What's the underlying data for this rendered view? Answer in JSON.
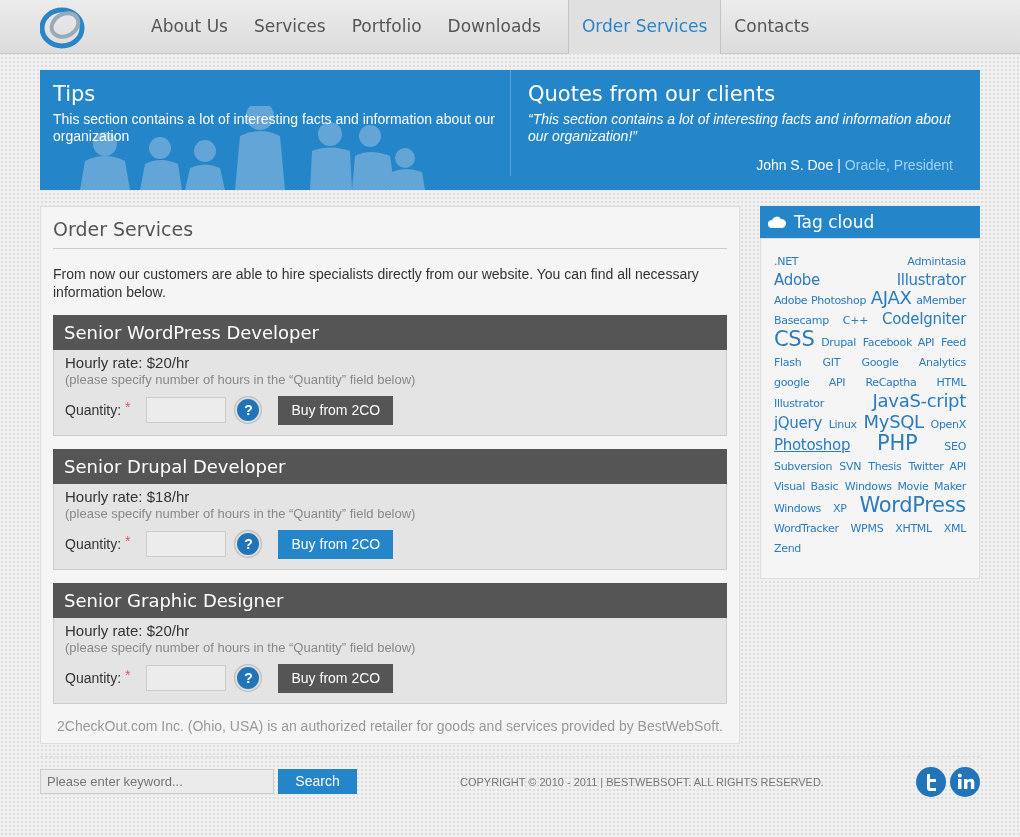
{
  "nav": [
    {
      "label": "About Us",
      "selected": false
    },
    {
      "label": "Services",
      "selected": false
    },
    {
      "label": "Portfolio",
      "selected": false
    },
    {
      "label": "Downloads",
      "selected": false
    },
    {
      "label": "Order Services",
      "selected": true
    },
    {
      "label": "Contacts",
      "selected": false
    }
  ],
  "banner": {
    "tips": {
      "title": "Tips",
      "text": "This section contains a lot of interesting facts and information about our organization"
    },
    "quote": {
      "title": "Quotes from our clients",
      "text": "“This section contains a lot of interesting facts and information about our organization!”",
      "author": "John S. Doe",
      "separator": "|",
      "company": "Oracle, President"
    }
  },
  "main": {
    "title": "Order Services",
    "intro": "From now our customers are able to hire specialists directly from our website. You can find all necessary information below.",
    "products": [
      {
        "title": "Senior WordPress Developer",
        "rate": "Hourly rate: $20/hr",
        "hint": "(please specify number of hours in the “Quantity” field below)",
        "quantity_label": "Quantity:",
        "required_mark": "*",
        "help": "?",
        "button": "Buy from 2CO",
        "highlighted": false
      },
      {
        "title": "Senior Drupal Developer",
        "rate": "Hourly rate: $18/hr",
        "hint": "(please specify number of hours in the “Quantity” field below)",
        "quantity_label": "Quantity:",
        "required_mark": "*",
        "help": "?",
        "button": "Buy from 2CO",
        "highlighted": true
      },
      {
        "title": "Senior Graphic Designer",
        "rate": "Hourly rate: $20/hr",
        "hint": "(please specify number of hours in the “Quantity” field below)",
        "quantity_label": "Quantity:",
        "required_mark": "*",
        "help": "?",
        "button": "Buy from 2CO",
        "highlighted": false
      }
    ],
    "note": "2CheckOut.com Inc. (Ohio, USA) is an authorized retailer for goods and services provided by BestWebSoft."
  },
  "tag_cloud": {
    "title": "Tag cloud",
    "tags": [
      {
        "label": ".NET",
        "kind": "small",
        "underlined": false
      },
      {
        "label": "Admintasia",
        "kind": "small",
        "underlined": false
      },
      {
        "label": "Adobe Illustrator",
        "kind": "large",
        "underlined": false
      },
      {
        "label": "Adobe Photoshop",
        "kind": "small",
        "underlined": false
      },
      {
        "label": "AJAX",
        "kind": "xlarge",
        "underlined": false
      },
      {
        "label": "aMember",
        "kind": "small",
        "underlined": false
      },
      {
        "label": "Basecamp",
        "kind": "small",
        "underlined": false
      },
      {
        "label": "C++",
        "kind": "small",
        "underlined": false
      },
      {
        "label": "CodeIgniter",
        "kind": "large",
        "underlined": false
      },
      {
        "label": "CSS",
        "kind": "huge",
        "underlined": false
      },
      {
        "label": "Drupal",
        "kind": "small",
        "underlined": false
      },
      {
        "label": "Facebook API",
        "kind": "small",
        "underlined": false
      },
      {
        "label": "Feed",
        "kind": "small",
        "underlined": false
      },
      {
        "label": "Flash",
        "kind": "small",
        "underlined": false
      },
      {
        "label": "GIT",
        "kind": "small",
        "underlined": false
      },
      {
        "label": "Google Analytics",
        "kind": "small",
        "underlined": false
      },
      {
        "label": "google API",
        "kind": "small",
        "underlined": false
      },
      {
        "label": "ReCaptha",
        "kind": "small",
        "underlined": false
      },
      {
        "label": "HTML",
        "kind": "small",
        "underlined": false
      },
      {
        "label": "Illustrator",
        "kind": "small",
        "underlined": false
      },
      {
        "label": "JavaS-cript",
        "kind": "xlarge",
        "underlined": false
      },
      {
        "label": "jQuery",
        "kind": "large",
        "underlined": false
      },
      {
        "label": "Linux",
        "kind": "small",
        "underlined": false
      },
      {
        "label": "MySQL",
        "kind": "xlarge",
        "underlined": false
      },
      {
        "label": "OpenX",
        "kind": "small",
        "underlined": false
      },
      {
        "label": "Photoshop",
        "kind": "large",
        "underlined": true
      },
      {
        "label": "PHP",
        "kind": "huge",
        "underlined": false
      },
      {
        "label": "SEO",
        "kind": "small",
        "underlined": false
      },
      {
        "label": "Subversion",
        "kind": "small",
        "underlined": false
      },
      {
        "label": "SVN",
        "kind": "small",
        "underlined": false
      },
      {
        "label": "Thesis",
        "kind": "small",
        "underlined": false
      },
      {
        "label": "Twitter API",
        "kind": "small",
        "underlined": false
      },
      {
        "label": "Visual Basic",
        "kind": "small",
        "underlined": false
      },
      {
        "label": "Windows Movie Maker",
        "kind": "small",
        "underlined": false
      },
      {
        "label": "Windows XP",
        "kind": "small",
        "underlined": false
      },
      {
        "label": "WordPress",
        "kind": "huge",
        "underlined": false
      },
      {
        "label": "WordTracker",
        "kind": "small",
        "underlined": false
      },
      {
        "label": "WPMS",
        "kind": "small",
        "underlined": false
      },
      {
        "label": "XHTML",
        "kind": "small",
        "underlined": false
      },
      {
        "label": "XML",
        "kind": "small",
        "underlined": false
      },
      {
        "label": "Zend",
        "kind": "small",
        "underlined": false
      }
    ]
  },
  "footer": {
    "search": {
      "placeholder": "Please enter keyword...",
      "button": "Search"
    },
    "copyright": "COPYRIGHT © 2010 - 2011 | BESTWEBSOFT. ALL RIGHTS RESERVED."
  }
}
